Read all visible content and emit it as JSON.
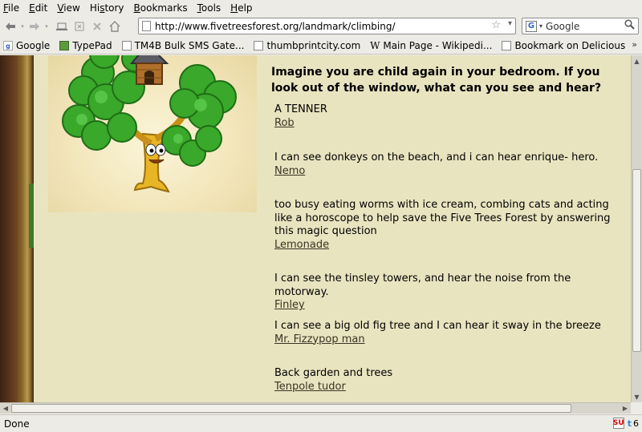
{
  "menu": [
    "File",
    "Edit",
    "View",
    "History",
    "Bookmarks",
    "Tools",
    "Help"
  ],
  "menu_accel": [
    "F",
    "E",
    "V",
    "s",
    "B",
    "T",
    "H"
  ],
  "url": "http://www.fivetreesforest.org/landmark/climbing/",
  "search": {
    "engine": "Google",
    "placeholder": "Google"
  },
  "bookmarks": [
    "Google",
    "TypePad",
    "TM4B Bulk SMS Gate...",
    "thumbprintcity.com",
    "Main Page - Wikipedi...",
    "Bookmark on Delicious"
  ],
  "question": "Imagine you are child again in your bedroom. If you look out of the window, what can you see and hear?",
  "answers": [
    {
      "text": "A TENNER",
      "author": "Rob"
    },
    {
      "text": "I can see donkeys on the beach, and i can hear enrique- hero.",
      "author": "Nemo"
    },
    {
      "text": "too busy eating worms with ice cream, combing cats and acting like a horoscope to help save the Five Trees Forest by answering this magic question",
      "author": "Lemonade"
    },
    {
      "text": "I can see the tinsley towers, and hear the noise from the motorway.",
      "author": "Finley"
    },
    {
      "text": "I can see a big old fig tree and I can hear it sway in the breeze",
      "author": "Mr. Fizzypop man"
    },
    {
      "text": "Back garden and trees",
      "author": "Tenpole tudor"
    }
  ],
  "status": {
    "text": "Done",
    "count": "6"
  },
  "colors": {
    "parchment": "#e9e4c0",
    "chrome": "#ecebe6",
    "tree_green": "#3aa82a",
    "trunk": "#e8b526"
  }
}
